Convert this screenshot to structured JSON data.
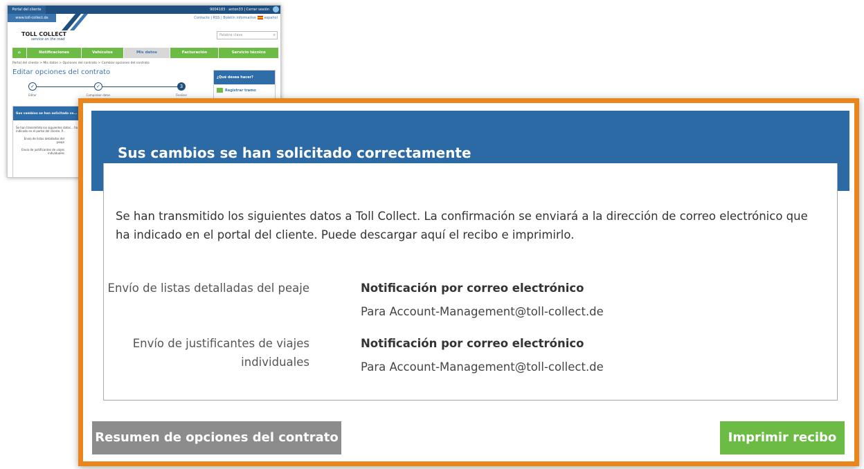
{
  "background": {
    "topbar": {
      "tab_portal": "Portal del cliente",
      "tab_site": "www.toll-collect.de",
      "user_id": "9004183 · anton33",
      "logout": "Cerrar sesión"
    },
    "header_links": "Contacto | RSS | Boletín informativo",
    "language": "español",
    "logo": "TOLL COLLECT",
    "tagline": "service on the road",
    "search_placeholder": "Palabra clave",
    "nav": [
      "Notificaciones",
      "Vehículos",
      "Mis datos",
      "Facturación",
      "Servicio técnico"
    ],
    "breadcrumb": "Portal del cliente > Mis datos > Opciones del contrato > Cambiar opciones del contrato",
    "page_title": "Editar opciones del contrato",
    "steps": [
      {
        "label": "Editar",
        "state": "done"
      },
      {
        "label": "Comprobar datos",
        "state": "done"
      },
      {
        "label": "Finalizar",
        "state": "current",
        "number": "3"
      }
    ],
    "sidebar": {
      "heading": "¿Qué desea hacer?",
      "item": "Registrar tramo"
    },
    "mini_success": {
      "heading": "Sus cambios se han solicitado co...",
      "text": "Se han transmitido los siguientes datos... ha indicado en el portal del cliente. P...",
      "row1": "Envío de listas detalladas del peaje",
      "row2": "Envío de justificantes de viajes individuales"
    }
  },
  "zoom": {
    "title": "Sus cambios se han solicitado correctamente",
    "intro": "Se han transmitido los siguientes datos a Toll Collect. La confirmación se enviará a la dirección de correo electrónico que ha indicado en el portal del cliente. Puede descargar aquí el recibo e imprimirlo.",
    "settings": [
      {
        "label": "Envío de listas detalladas del peaje",
        "value": "Notificación por correo electrónico",
        "detail": "Para Account-Management@toll-collect.de"
      },
      {
        "label": "Envío de justificantes de viajes individuales",
        "value": "Notificación por correo electrónico",
        "detail": "Para Account-Management@toll-collect.de"
      }
    ],
    "btn_summary": "Resumen de opciones del contrato",
    "btn_print": "Imprimir recibo"
  },
  "colors": {
    "frame": "#e8861b",
    "header_blue": "#2c6aa5",
    "green": "#6cbb44",
    "gray_button": "#8c8c8c"
  }
}
